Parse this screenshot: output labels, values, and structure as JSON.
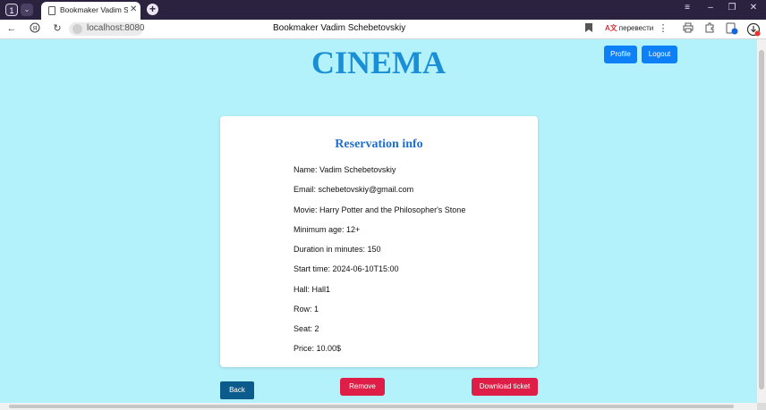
{
  "browser": {
    "tab_count": "1",
    "tab_title": "Bookmaker Vadim Sche",
    "url": "localhost:8080",
    "page_title": "Bookmaker Vadim Schebetovskiy",
    "translate_label": "перевести",
    "window_controls": [
      "≡",
      "–",
      "❐",
      "✕"
    ]
  },
  "header": {
    "brand": "CINEMA",
    "profile_label": "Profile",
    "logout_label": "Logout"
  },
  "reservation": {
    "title": "Reservation info",
    "lines": [
      "Name: Vadim Schebetovskiy",
      "Email: schebetovskiy@gmail.com",
      "Movie: Harry Potter and the Philosopher's Stone",
      "Minimum age: 12+",
      "Duration in minutes: 150",
      "Start time: 2024-06-10T15:00",
      "Hall: Hall1",
      "Row: 1",
      "Seat: 2",
      "Price: 10.00$"
    ]
  },
  "actions": {
    "back_label": "Back",
    "remove_label": "Remove",
    "download_label": "Download ticket"
  },
  "colors": {
    "page_bg": "#b3f2fb",
    "brand": "#1a8fd6",
    "primary": "#0d7ff7",
    "danger": "#de1e46",
    "back": "#0b5c8c"
  }
}
